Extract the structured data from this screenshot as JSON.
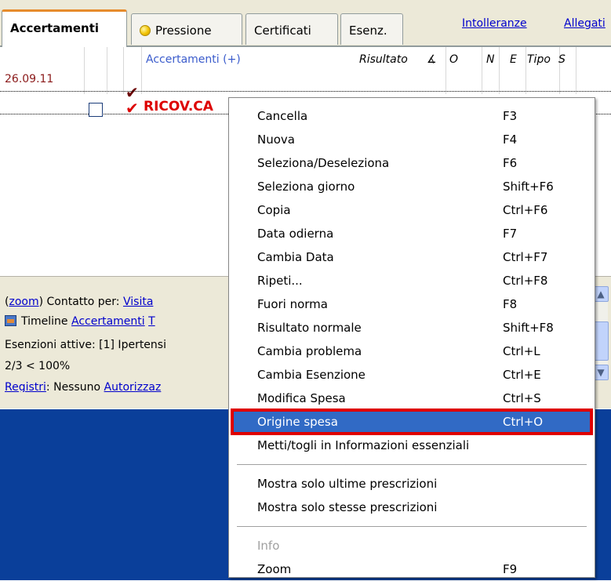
{
  "tabs": [
    {
      "label": "Accertamenti"
    },
    {
      "label": "Pressione"
    },
    {
      "label": "Certificati"
    },
    {
      "label": "Esenz."
    }
  ],
  "top_links": [
    "Intolleranze",
    "Allegati"
  ],
  "grid": {
    "headers": {
      "accertamenti": "Accertamenti (+)",
      "risultato": "Risultato",
      "o": "O",
      "n": "N",
      "e": "E",
      "tipo": "Tipo",
      "s": "S"
    },
    "row_date": "26.09.11",
    "row_title": "RICOV.CA"
  },
  "info": {
    "zoom_link": "zoom",
    "contatto_label": "Contatto per:",
    "contatto_link": "Visita",
    "timeline_label": "Timeline",
    "timeline_link": "Accertamenti",
    "timeline_link2": "T",
    "esenzioni": "Esenzioni attive: [1] Ipertensi",
    "ratio": "2/3 < 100%",
    "registri_link": "Registri",
    "registri_value": "Nessuno",
    "autorizz_link": "Autorizzaz"
  },
  "menu": {
    "items": [
      {
        "label": "Cancella",
        "shortcut": "F3"
      },
      {
        "label": "Nuova",
        "shortcut": "F4"
      },
      {
        "label": "Seleziona/Deseleziona",
        "shortcut": "F6"
      },
      {
        "label": "Seleziona giorno",
        "shortcut": "Shift+F6"
      },
      {
        "label": "Copia",
        "shortcut": "Ctrl+F6"
      },
      {
        "label": "Data odierna",
        "shortcut": "F7"
      },
      {
        "label": "Cambia Data",
        "shortcut": "Ctrl+F7"
      },
      {
        "label": "Ripeti...",
        "shortcut": "Ctrl+F8"
      },
      {
        "label": "Fuori norma",
        "shortcut": "F8"
      },
      {
        "label": "Risultato normale",
        "shortcut": "Shift+F8"
      },
      {
        "label": "Cambia problema",
        "shortcut": "Ctrl+L"
      },
      {
        "label": "Cambia Esenzione",
        "shortcut": "Ctrl+E"
      },
      {
        "label": "Modifica Spesa",
        "shortcut": "Ctrl+S"
      },
      {
        "label": "Origine spesa",
        "shortcut": "Ctrl+O"
      },
      {
        "label": "Metti/togli in Informazioni essenziali",
        "shortcut": ""
      },
      {
        "label": "Mostra solo ultime prescrizioni",
        "shortcut": ""
      },
      {
        "label": "Mostra solo stesse prescrizioni",
        "shortcut": ""
      },
      {
        "label": "Info",
        "shortcut": ""
      },
      {
        "label": "Zoom",
        "shortcut": "F9"
      }
    ]
  },
  "colors": {
    "highlight": "#316ac5",
    "highlight_outline": "#e00000",
    "desktop_blue": "#0a3f9a",
    "red_text": "#dd0000"
  }
}
